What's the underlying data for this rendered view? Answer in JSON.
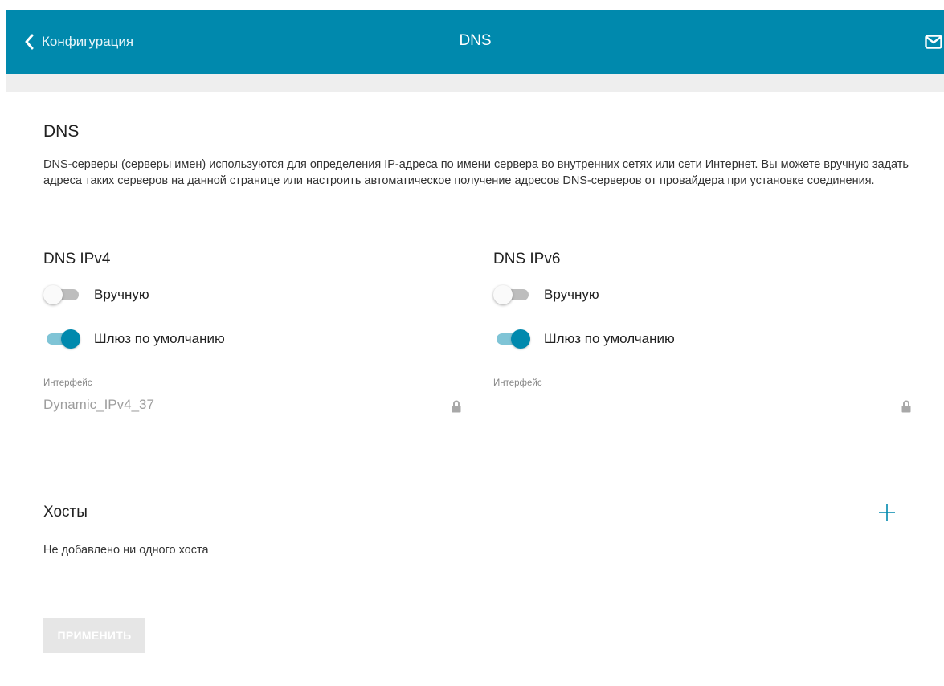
{
  "header": {
    "back_label": "Конфигурация",
    "title": "DNS",
    "back_icon": "chevron-left-icon",
    "mail_icon": "mail-icon"
  },
  "colors": {
    "header_bg": "#0089ad",
    "accent": "#0089ad",
    "toggle_track_on": "#7fc4d6",
    "apply_disabled_bg": "#e6e6e6"
  },
  "dns": {
    "title": "DNS",
    "description": "DNS-серверы (серверы имен) используются для определения IP-адреса по имени сервера во внутренних сетях или сети Интернет. Вы можете вручную задать адреса таких серверов на данной странице или настроить автоматическое получение адресов DNS-серверов от провайдера при установке соединения."
  },
  "ipv4": {
    "title": "DNS IPv4",
    "manual_label": "Вручную",
    "manual_on": false,
    "gateway_label": "Шлюз по умолчанию",
    "gateway_on": true,
    "interface_label": "Интерфейс",
    "interface_value": "Dynamic_IPv4_37",
    "lock_icon": "lock-icon"
  },
  "ipv6": {
    "title": "DNS IPv6",
    "manual_label": "Вручную",
    "manual_on": false,
    "gateway_label": "Шлюз по умолчанию",
    "gateway_on": true,
    "interface_label": "Интерфейс",
    "interface_value": "",
    "lock_icon": "lock-icon"
  },
  "hosts": {
    "title": "Хосты",
    "empty_text": "Не добавлено ни одного хоста",
    "add_icon": "plus-icon"
  },
  "apply_label": "ПРИМЕНИТЬ"
}
